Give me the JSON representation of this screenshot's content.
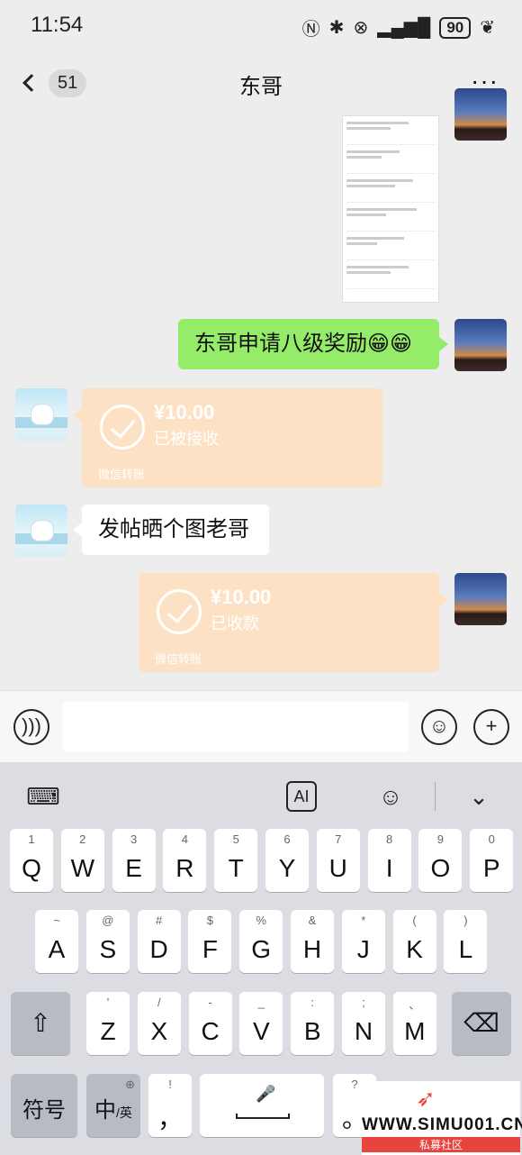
{
  "status_bar": {
    "time": "11:54",
    "battery": "90"
  },
  "nav": {
    "back_count": "51",
    "title": "东哥"
  },
  "messages": [
    {
      "from": "me",
      "type": "image",
      "desc": "screenshot"
    },
    {
      "from": "me",
      "type": "text",
      "text": "东哥申请八级奖励😁😁"
    },
    {
      "from": "other",
      "type": "transfer",
      "amount": "¥10.00",
      "status": "已被接收",
      "label": "微信转账"
    },
    {
      "from": "other",
      "type": "text",
      "text": "发帖晒个图老哥"
    },
    {
      "from": "me",
      "type": "transfer",
      "amount": "¥10.00",
      "status": "已收款",
      "label": "微信转账"
    }
  ],
  "input": {
    "placeholder": ""
  },
  "keyboard": {
    "row1": [
      {
        "k": "Q",
        "s": "1"
      },
      {
        "k": "W",
        "s": "2"
      },
      {
        "k": "E",
        "s": "3"
      },
      {
        "k": "R",
        "s": "4"
      },
      {
        "k": "T",
        "s": "5"
      },
      {
        "k": "Y",
        "s": "6"
      },
      {
        "k": "U",
        "s": "7"
      },
      {
        "k": "I",
        "s": "8"
      },
      {
        "k": "O",
        "s": "9"
      },
      {
        "k": "P",
        "s": "0"
      }
    ],
    "row2": [
      {
        "k": "A",
        "s": "~"
      },
      {
        "k": "S",
        "s": "@"
      },
      {
        "k": "D",
        "s": "#"
      },
      {
        "k": "F",
        "s": "$"
      },
      {
        "k": "G",
        "s": "%"
      },
      {
        "k": "H",
        "s": "&"
      },
      {
        "k": "J",
        "s": "*"
      },
      {
        "k": "K",
        "s": "("
      },
      {
        "k": "L",
        "s": ")"
      }
    ],
    "row3": [
      {
        "k": "Z",
        "s": "'"
      },
      {
        "k": "X",
        "s": "/"
      },
      {
        "k": "C",
        "s": "-"
      },
      {
        "k": "V",
        "s": "_"
      },
      {
        "k": "B",
        "s": ":"
      },
      {
        "k": "N",
        "s": ";"
      },
      {
        "k": "M",
        "s": "、"
      }
    ],
    "symbols_label": "符号",
    "lang_main": "中",
    "lang_sub": "/英",
    "comma_key": {
      "k": "，",
      "s": "!"
    },
    "period_key": {
      "k": "。",
      "s": "?"
    },
    "ai_label": "AI"
  },
  "watermark": {
    "site": "WWW.SIMU001.CN",
    "name": "私募社区"
  }
}
